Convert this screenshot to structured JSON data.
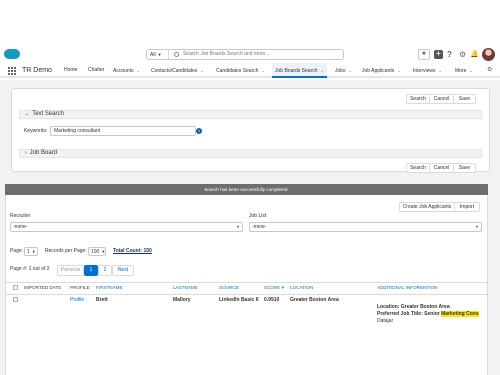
{
  "global_header": {
    "search_scope": "All",
    "search_placeholder": "Search Job Boards Search and more...",
    "brand_color": "#1798c1"
  },
  "nav": {
    "app_name": "TR Demo",
    "items": [
      {
        "label": "Home",
        "has_menu": false
      },
      {
        "label": "Chatter",
        "has_menu": false
      },
      {
        "label": "Accounts",
        "has_menu": true
      },
      {
        "label": "Contacts/Candidates",
        "has_menu": true
      },
      {
        "label": "Candidates Search",
        "has_menu": true
      },
      {
        "label": "Job Boards Search",
        "has_menu": true,
        "active": true
      },
      {
        "label": "Jobs",
        "has_menu": true
      },
      {
        "label": "Job Applicants",
        "has_menu": true
      },
      {
        "label": "Interviews",
        "has_menu": true
      },
      {
        "label": "More",
        "has_menu": true
      }
    ]
  },
  "search_card": {
    "top_buttons": [
      "Search",
      "Cancel",
      "Save"
    ],
    "text_search_label": "Text Search",
    "keywords_label": "Keywords",
    "keywords_value": "Marketing consultant",
    "job_board_label": "Job Board",
    "bottom_buttons": [
      "Search",
      "Cancel",
      "Save"
    ]
  },
  "results": {
    "status_message": "Search has been successfully completed.",
    "action_buttons": [
      "Create Job Applicants",
      "Import"
    ],
    "recruiter_label": "Recruiter",
    "recruiter_value": "-none-",
    "job_list_label": "Job List",
    "job_list_value": "-none-",
    "page_label": "Page:",
    "page_value": "1",
    "records_label": "Records per Page:",
    "records_value": "100",
    "total_count": "Total Count: 150",
    "page_info": "Page #: 1 out of 2",
    "pager": [
      "Previous",
      "1",
      "2",
      "Next"
    ],
    "columns": [
      "Imported Date",
      "Profile",
      "Firstname",
      "Lastname",
      "Source",
      "Score",
      "Location",
      "Additional Information"
    ],
    "rows": [
      {
        "imported_date": "",
        "profile": "Profile",
        "firstname": "Brett",
        "lastname": "Mallory",
        "source": "LinkedIn Basic II",
        "score": "0.9910",
        "location": "Greater Boston Area",
        "additional": {
          "location_line": "Location: Greater Boston Area",
          "title_prefix": "Preferred Job Title: Senior ",
          "title_highlight": "Marketing Cons",
          "extra": "Datajar"
        }
      }
    ]
  }
}
